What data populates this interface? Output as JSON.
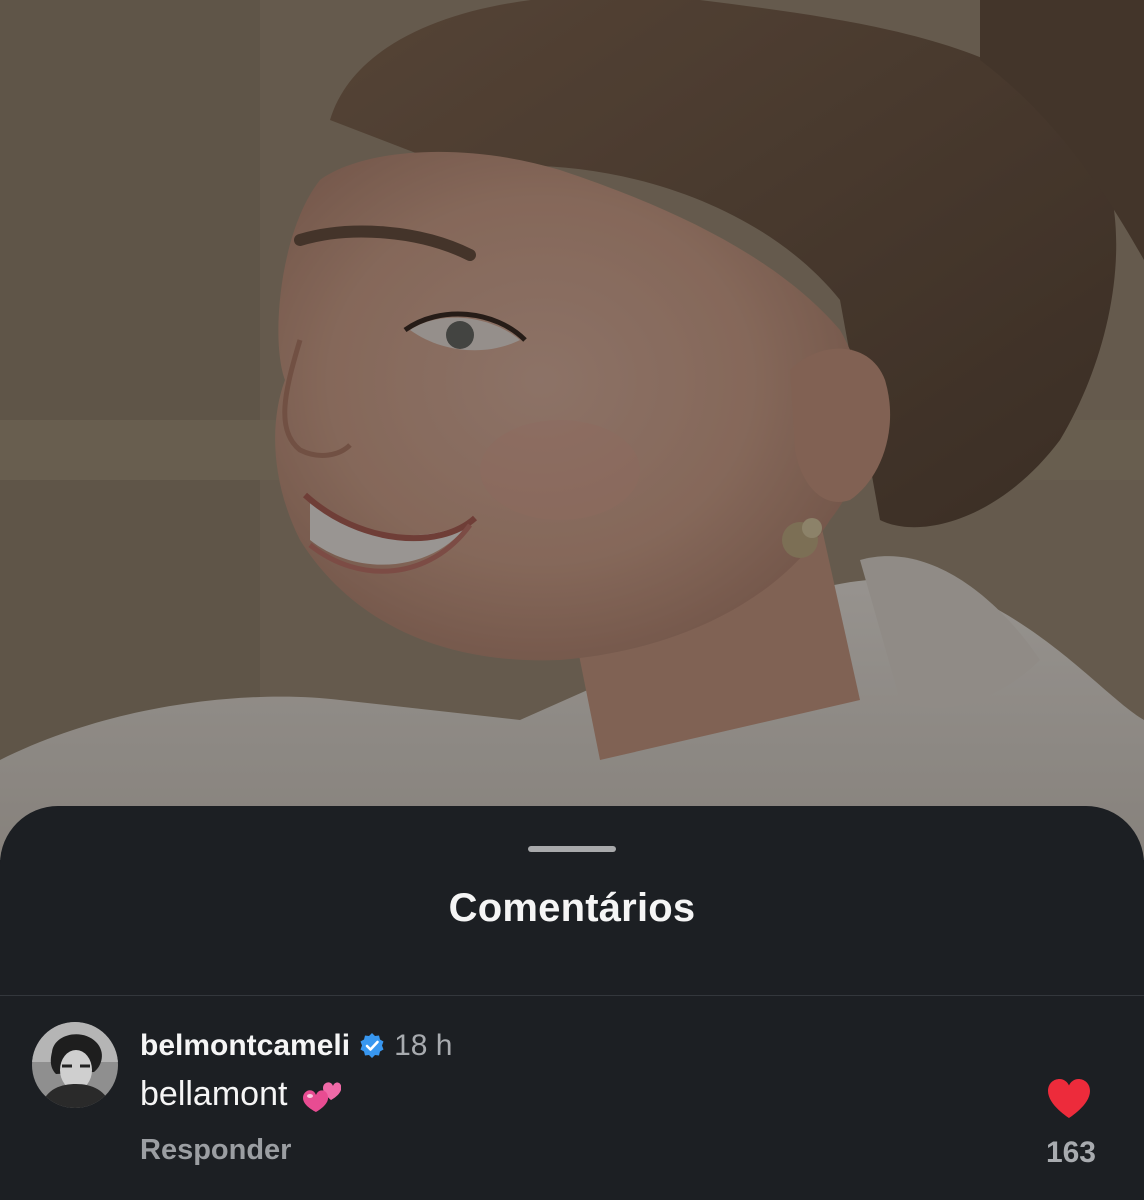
{
  "sheet": {
    "title": "Comentários"
  },
  "comment": {
    "username": "belmontcameli",
    "verified": true,
    "time": "18 h",
    "text": "bellamont",
    "emoji": "two-hearts-emoji",
    "reply_label": "Responder",
    "like_count": "163",
    "liked": true
  },
  "colors": {
    "sheet_background": "#1c1f23",
    "like_red": "#ed2b3b",
    "verified_blue": "#3897f0",
    "secondary_text": "#a8abaf"
  },
  "icons": {
    "verified": "verified-badge-icon",
    "like": "heart-icon",
    "grabber": "sheet-grabber"
  }
}
